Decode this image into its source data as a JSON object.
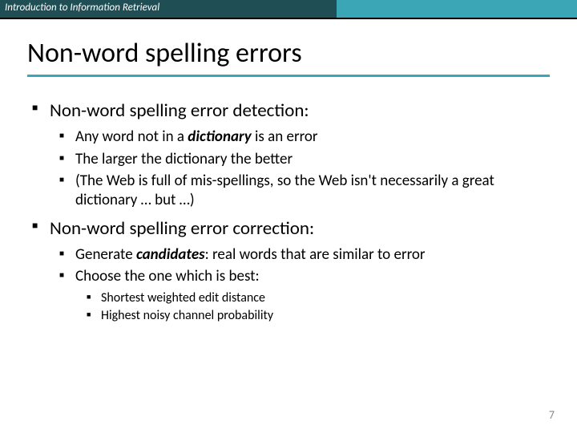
{
  "header": {
    "course": "Introduction to Information Retrieval"
  },
  "title": "Non-word spelling errors",
  "bullets": {
    "b1": {
      "text": "Non-word spelling error detection:",
      "sub": {
        "s1_pre": "Any word not in a ",
        "s1_em": "dictionary",
        "s1_post": " is an error",
        "s2": "The larger the dictionary the better",
        "s3": "(The Web is full of mis-spellings, so the Web isn't necessarily a great dictionary … but …)"
      }
    },
    "b2": {
      "text": "Non-word spelling error correction:",
      "sub": {
        "s1_pre": "Generate ",
        "s1_em": "candidates",
        "s1_post": ": real words that are similar to error",
        "s2": "Choose the one which is best:",
        "s2sub": {
          "a": "Shortest weighted edit distance",
          "b": "Highest noisy channel probability"
        }
      }
    }
  },
  "page_number": "7"
}
